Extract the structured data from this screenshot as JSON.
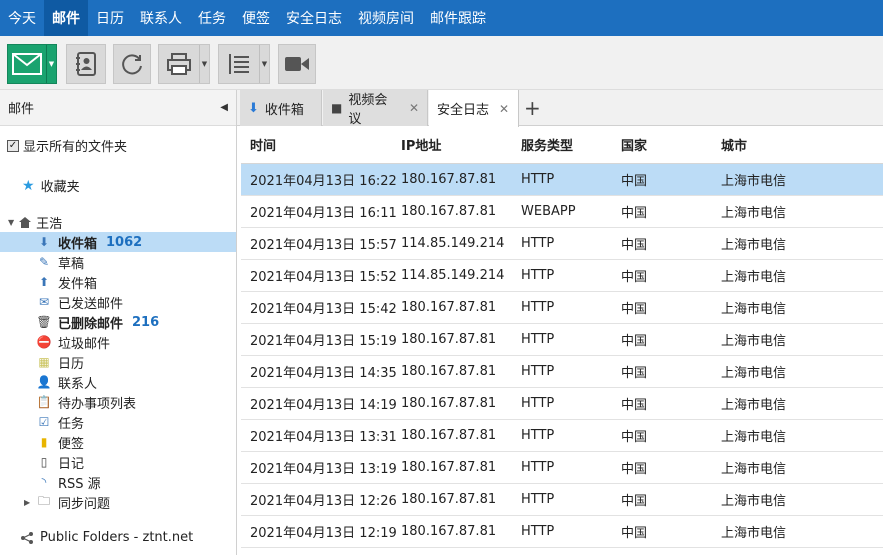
{
  "topnav": [
    "今天",
    "邮件",
    "日历",
    "联系人",
    "任务",
    "便签",
    "安全日志",
    "视频房间",
    "邮件跟踪"
  ],
  "left": {
    "title": "邮件",
    "show_all": "显示所有的文件夹",
    "favorites": "收藏夹",
    "user": "王浩",
    "folders": [
      {
        "label": "收件箱",
        "count": "1062"
      },
      {
        "label": "草稿",
        "count": ""
      },
      {
        "label": "发件箱",
        "count": ""
      },
      {
        "label": "已发送邮件",
        "count": ""
      },
      {
        "label": "已删除邮件",
        "count": "216"
      },
      {
        "label": "垃圾邮件",
        "count": ""
      },
      {
        "label": "日历",
        "count": ""
      },
      {
        "label": "联系人",
        "count": ""
      },
      {
        "label": "待办事项列表",
        "count": ""
      },
      {
        "label": "任务",
        "count": ""
      },
      {
        "label": "便签",
        "count": ""
      },
      {
        "label": "日记",
        "count": ""
      },
      {
        "label": "RSS 源",
        "count": ""
      },
      {
        "label": "同步问题",
        "count": ""
      }
    ],
    "public_folders": "Public Folders - ztnt.net"
  },
  "tabs": [
    "收件箱",
    "视频会议",
    "安全日志"
  ],
  "table": {
    "headers": [
      "时间",
      "IP地址",
      "服务类型",
      "国家",
      "城市"
    ],
    "rows": [
      [
        "2021年04月13日 16:22",
        "180.167.87.81",
        "HTTP",
        "中国",
        "上海市电信"
      ],
      [
        "2021年04月13日 16:11",
        "180.167.87.81",
        "WEBAPP",
        "中国",
        "上海市电信"
      ],
      [
        "2021年04月13日 15:57",
        "114.85.149.214",
        "HTTP",
        "中国",
        "上海市电信"
      ],
      [
        "2021年04月13日 15:52",
        "114.85.149.214",
        "HTTP",
        "中国",
        "上海市电信"
      ],
      [
        "2021年04月13日 15:42",
        "180.167.87.81",
        "HTTP",
        "中国",
        "上海市电信"
      ],
      [
        "2021年04月13日 15:19",
        "180.167.87.81",
        "HTTP",
        "中国",
        "上海市电信"
      ],
      [
        "2021年04月13日 14:35",
        "180.167.87.81",
        "HTTP",
        "中国",
        "上海市电信"
      ],
      [
        "2021年04月13日 14:19",
        "180.167.87.81",
        "HTTP",
        "中国",
        "上海市电信"
      ],
      [
        "2021年04月13日 13:31",
        "180.167.87.81",
        "HTTP",
        "中国",
        "上海市电信"
      ],
      [
        "2021年04月13日 13:19",
        "180.167.87.81",
        "HTTP",
        "中国",
        "上海市电信"
      ],
      [
        "2021年04月13日 12:26",
        "180.167.87.81",
        "HTTP",
        "中国",
        "上海市电信"
      ],
      [
        "2021年04月13日 12:19",
        "180.167.87.81",
        "HTTP",
        "中国",
        "上海市电信"
      ]
    ]
  },
  "colors": {
    "nav": "#1d6fbf",
    "selection": "#bcdcf6",
    "mail_button": "#1aa36f"
  }
}
